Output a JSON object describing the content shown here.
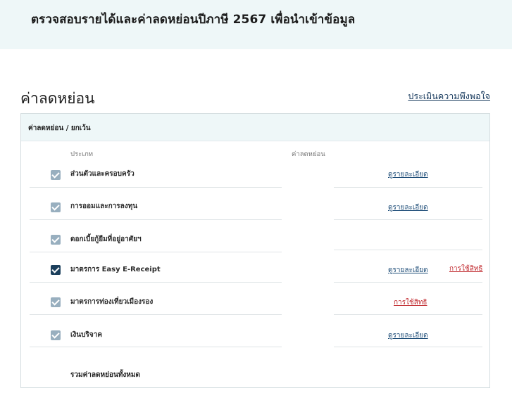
{
  "banner": {
    "title": "ตรวจสอบรายได้และค่าลดหย่อนปีภาษี 2567 เพื่อนำเข้าข้อมูล"
  },
  "section": {
    "title": "ค่าลดหย่อน",
    "survey_link": "ประเมินความพึงพอใจ"
  },
  "card": {
    "header": "ค่าลดหย่อน / ยกเว้น",
    "columns": {
      "type": "ประเภท",
      "amount": "ค่าลดหย่อน"
    },
    "rows": [
      {
        "label": "ส่วนตัวและครอบครัว",
        "checked": true,
        "detail": "ดูรายละเอียด"
      },
      {
        "label": "การออมและการลงทุน",
        "checked": true,
        "detail": "ดูรายละเอียด"
      },
      {
        "label": "ดอกเบี้ยกู้ยืมที่อยู่อาศัยฯ",
        "checked": true
      },
      {
        "label": "มาตรการ Easy E-Receipt",
        "checked": true,
        "focused": true,
        "detail": "ดูรายละเอียด",
        "right_link": "การใช้สิทธิ"
      },
      {
        "label": "มาตรการท่องเที่ยวเมืองรอง",
        "checked": true,
        "right_link": "การใช้สิทธิ"
      },
      {
        "label": "เงินบริจาค",
        "checked": true,
        "detail": "ดูรายละเอียด"
      }
    ],
    "total_label": "รวมค่าลดหย่อนทั้งหมด"
  }
}
